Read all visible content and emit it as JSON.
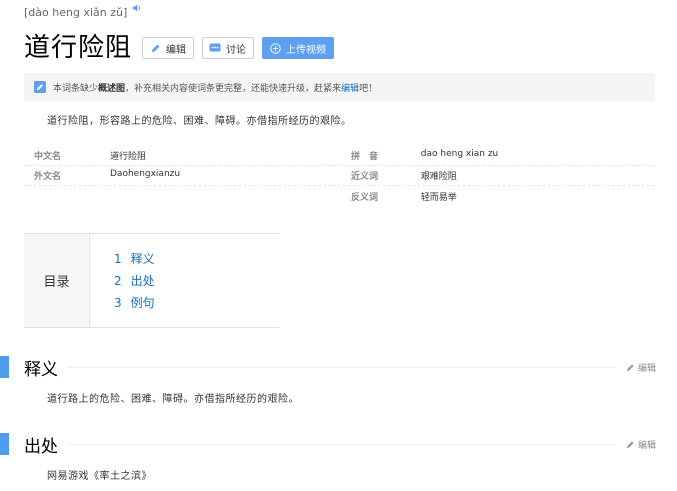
{
  "pinyin": "[dào heng xiǎn zǔ]",
  "title": "道行险阻",
  "buttons": {
    "edit": "编辑",
    "discuss": "讨论",
    "upload": "上传视频"
  },
  "notice": {
    "prefix": "本词条缺少",
    "bold": "概述图",
    "middle": "，补充相关内容使词条更完整，还能快速升级，赶紧来",
    "link": "编辑",
    "suffix": "吧！"
  },
  "summary": "道行险阻，形容路上的危险、困难、障碍。亦借指所经历的艰险。",
  "info": {
    "left": [
      {
        "key": "中文名",
        "value": "道行险阻"
      },
      {
        "key": "外文名",
        "value": "Daohengxianzu"
      }
    ],
    "right": [
      {
        "key": "拼　音",
        "value": "dao heng xian zu"
      },
      {
        "key": "近义词",
        "value": "艰难险阻"
      },
      {
        "key": "反义词",
        "value": "轻而易举"
      }
    ]
  },
  "toc": {
    "title": "目录",
    "items": [
      {
        "num": "1",
        "label": "释义"
      },
      {
        "num": "2",
        "label": "出处"
      },
      {
        "num": "3",
        "label": "例句"
      }
    ]
  },
  "sections": [
    {
      "title": "释义",
      "edit": "编辑",
      "text": "道行路上的危险、困难、障碍。亦借指所经历的艰险。"
    },
    {
      "title": "出处",
      "edit": "编辑",
      "text": "网易游戏《率土之滨》"
    }
  ],
  "colors": {
    "accent": "#4f9cee",
    "link": "#136ec2",
    "upload_button": "#5d9ff1"
  }
}
